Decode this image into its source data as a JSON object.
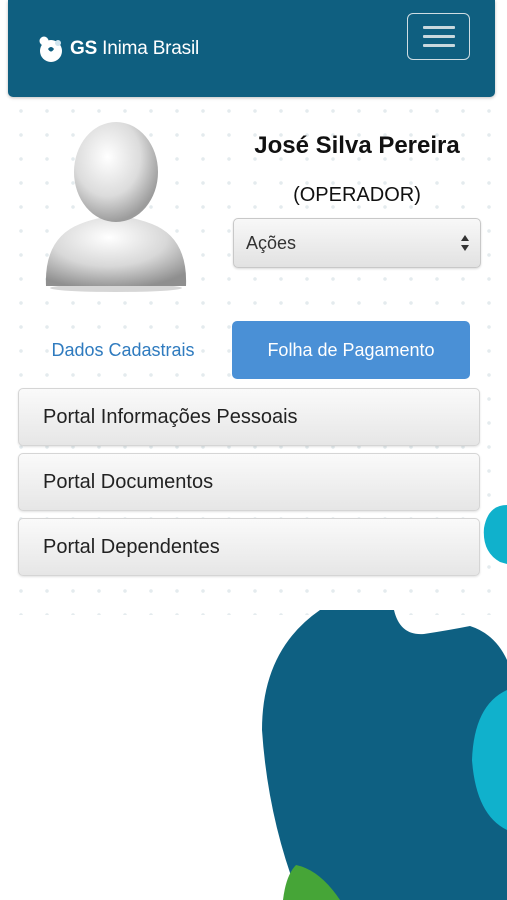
{
  "header": {
    "logo_bold": "GS",
    "logo_rest": "Inima Brasil",
    "menu_icon": "hamburger-menu-icon",
    "brand_color": "#0f5f80"
  },
  "profile": {
    "name": "José Silva Pereira",
    "role": "(OPERADOR)",
    "actions_select": {
      "selected": "Ações"
    }
  },
  "tabs": [
    {
      "label": "Dados Cadastrais",
      "active": false
    },
    {
      "label": "Folha de Pagamento",
      "active": true
    }
  ],
  "portal_items": [
    {
      "label": "Portal Informações Pessoais"
    },
    {
      "label": "Portal Documentos"
    },
    {
      "label": "Portal Dependentes"
    }
  ],
  "colors": {
    "accent": "#4a90d6",
    "link": "#2f7bbf",
    "shape_dark": "#0e6082",
    "shape_cyan": "#10b1cc",
    "shape_green": "#46a537"
  }
}
